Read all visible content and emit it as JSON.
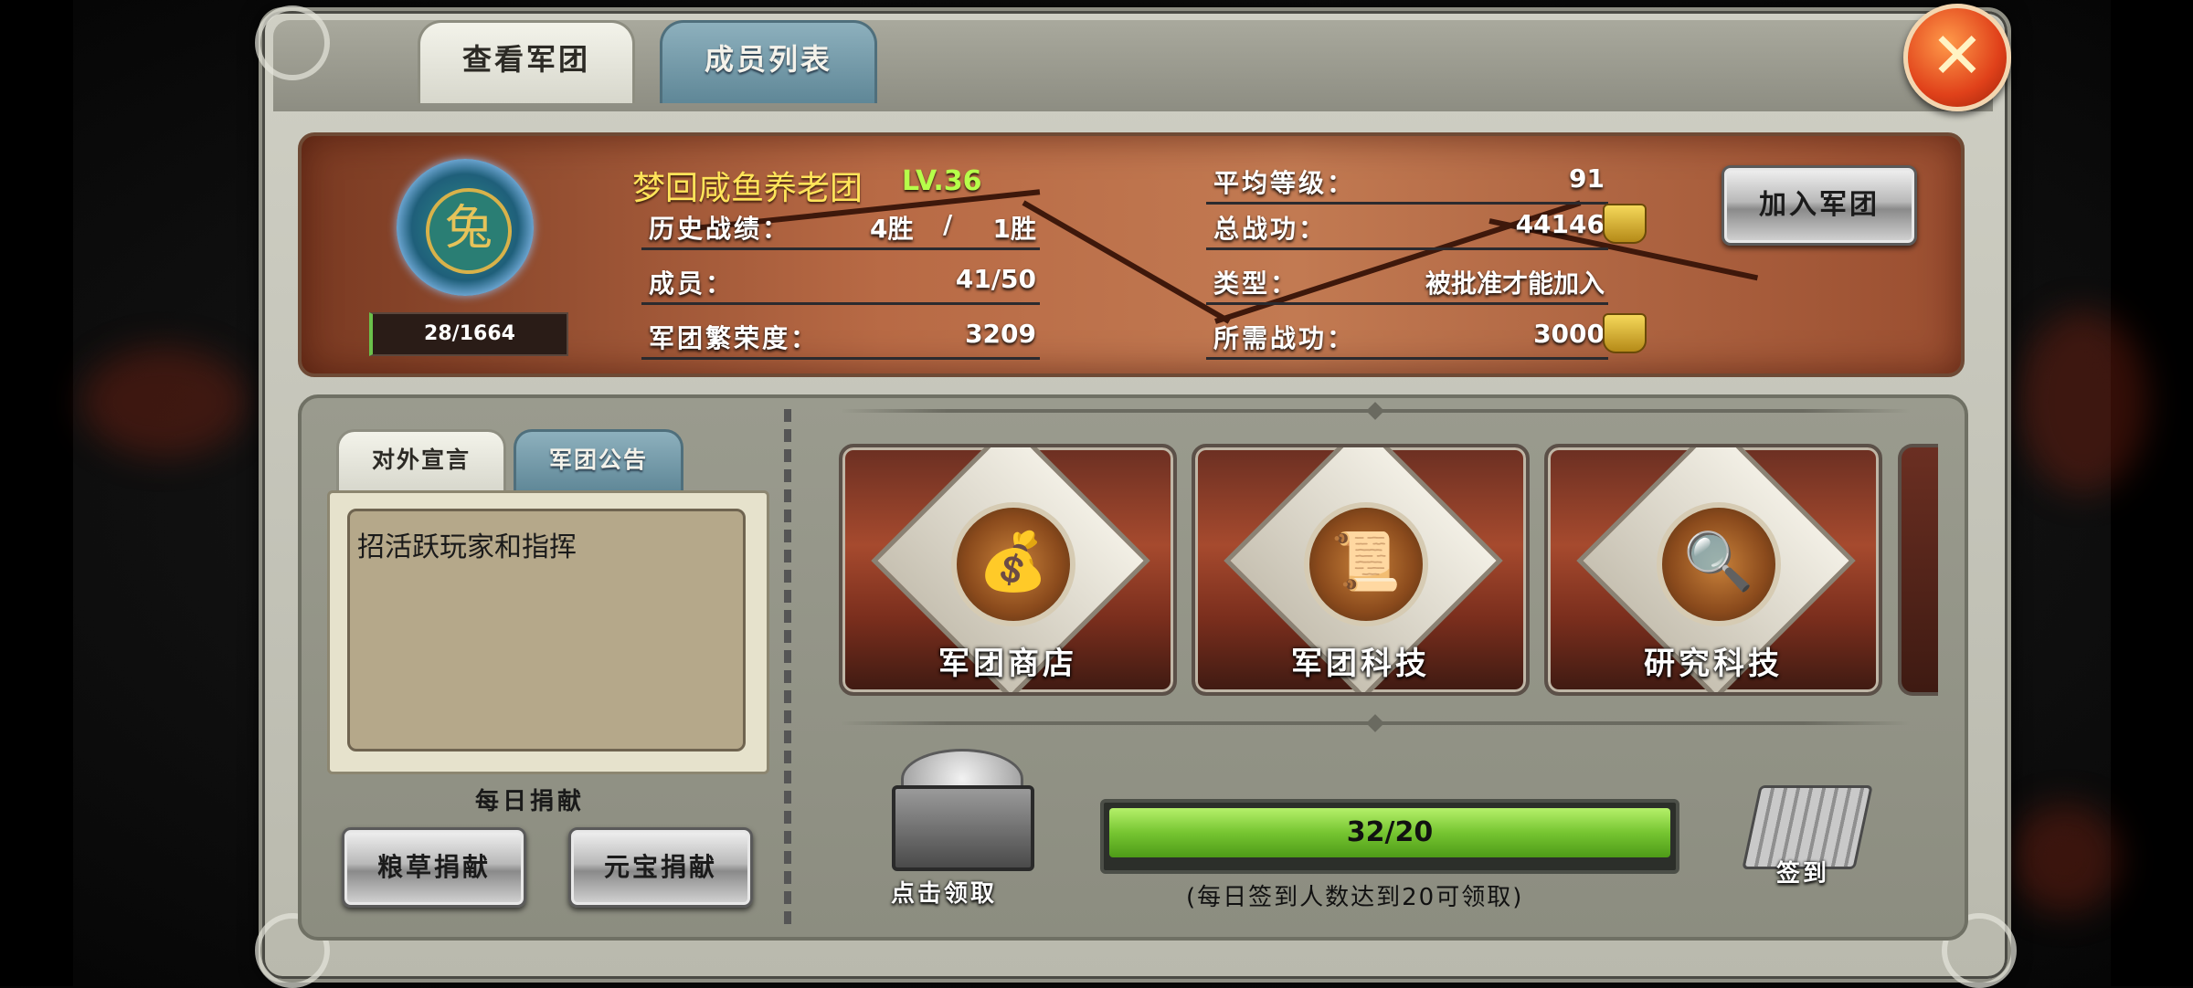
{
  "tabs": [
    {
      "label": "查看军团",
      "active": true
    },
    {
      "label": "成员列表",
      "active": false
    }
  ],
  "close_icon": "close-x-icon",
  "guild": {
    "name": "梦回咸鱼养老团",
    "level": "LV.36",
    "emblem_icon": "rabbit-emblem-icon",
    "exp": "28/1664",
    "history_label": "历史战绩：",
    "history_wins": "4胜",
    "history_sep": "/",
    "history_wins2": "1胜",
    "members_label": "成员：",
    "members_value": "41/50",
    "prosperity_label": "军团繁荣度：",
    "prosperity_value": "3209",
    "avg_level_label": "平均等级：",
    "avg_level_value": "91",
    "total_power_label": "总战功：",
    "total_power_value": "44146",
    "type_label": "类型：",
    "type_value": "被批准才能加入",
    "required_power_label": "所需战功：",
    "required_power_value": "3000",
    "join_button": "加入军团"
  },
  "notice": {
    "tabs": [
      {
        "label": "对外宣言",
        "active": true
      },
      {
        "label": "军团公告",
        "active": false
      }
    ],
    "content": "招活跃玩家和指挥"
  },
  "donate": {
    "title": "每日捐献",
    "grain_button": "粮草捐献",
    "gold_button": "元宝捐献"
  },
  "features": [
    {
      "label": "军团商店",
      "icon": "money-bag-icon"
    },
    {
      "label": "军团科技",
      "icon": "scroll-icon"
    },
    {
      "label": "研究科技",
      "icon": "magnifier-scroll-icon"
    }
  ],
  "checkin": {
    "claim_label": "点击领取",
    "progress_text": "32/20",
    "progress_fraction": 1.0,
    "note": "(每日签到人数达到20可领取)",
    "signin_label": "签到"
  }
}
